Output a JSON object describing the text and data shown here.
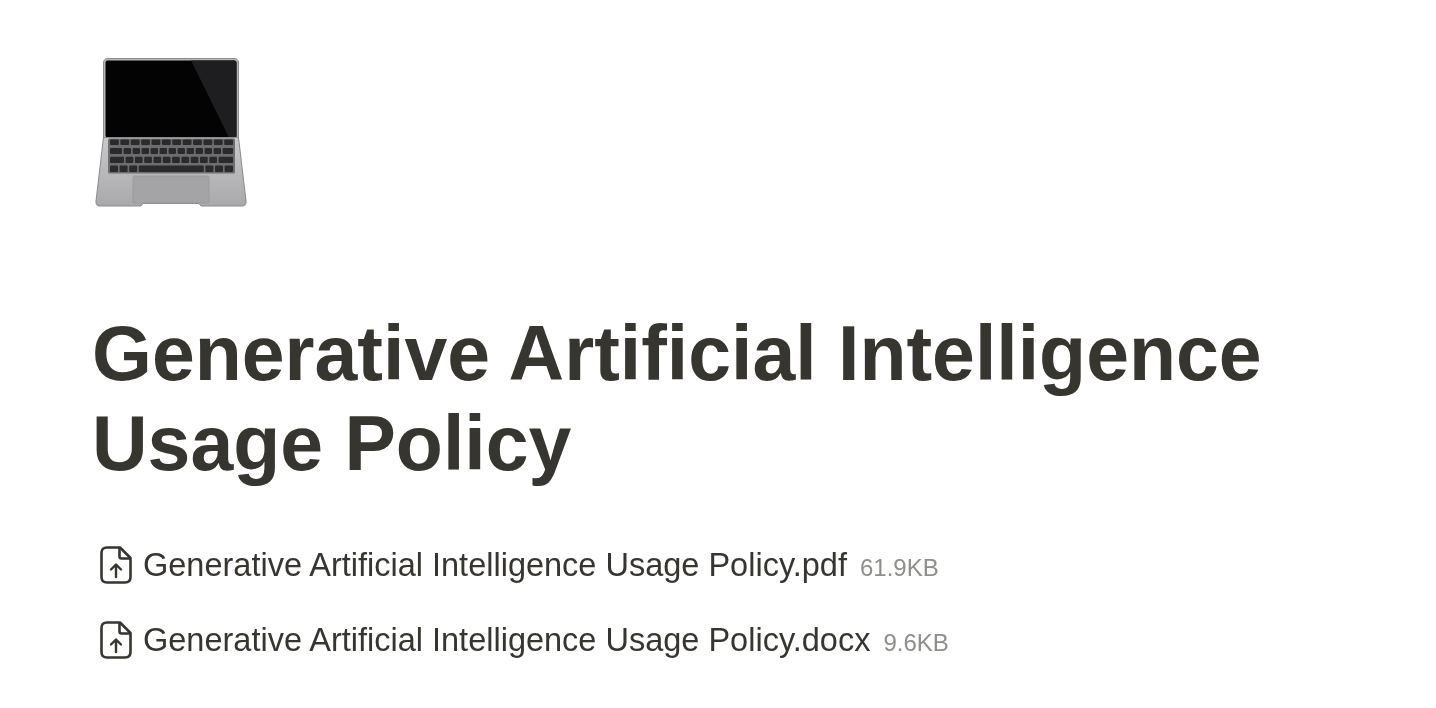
{
  "title": "Generative Artificial Intelligence Usage Policy",
  "attachments": [
    {
      "name": "Generative Artificial Intelligence Usage Policy.pdf",
      "size": "61.9KB"
    },
    {
      "name": "Generative Artificial Intelligence Usage Policy.docx",
      "size": "9.6KB"
    }
  ]
}
